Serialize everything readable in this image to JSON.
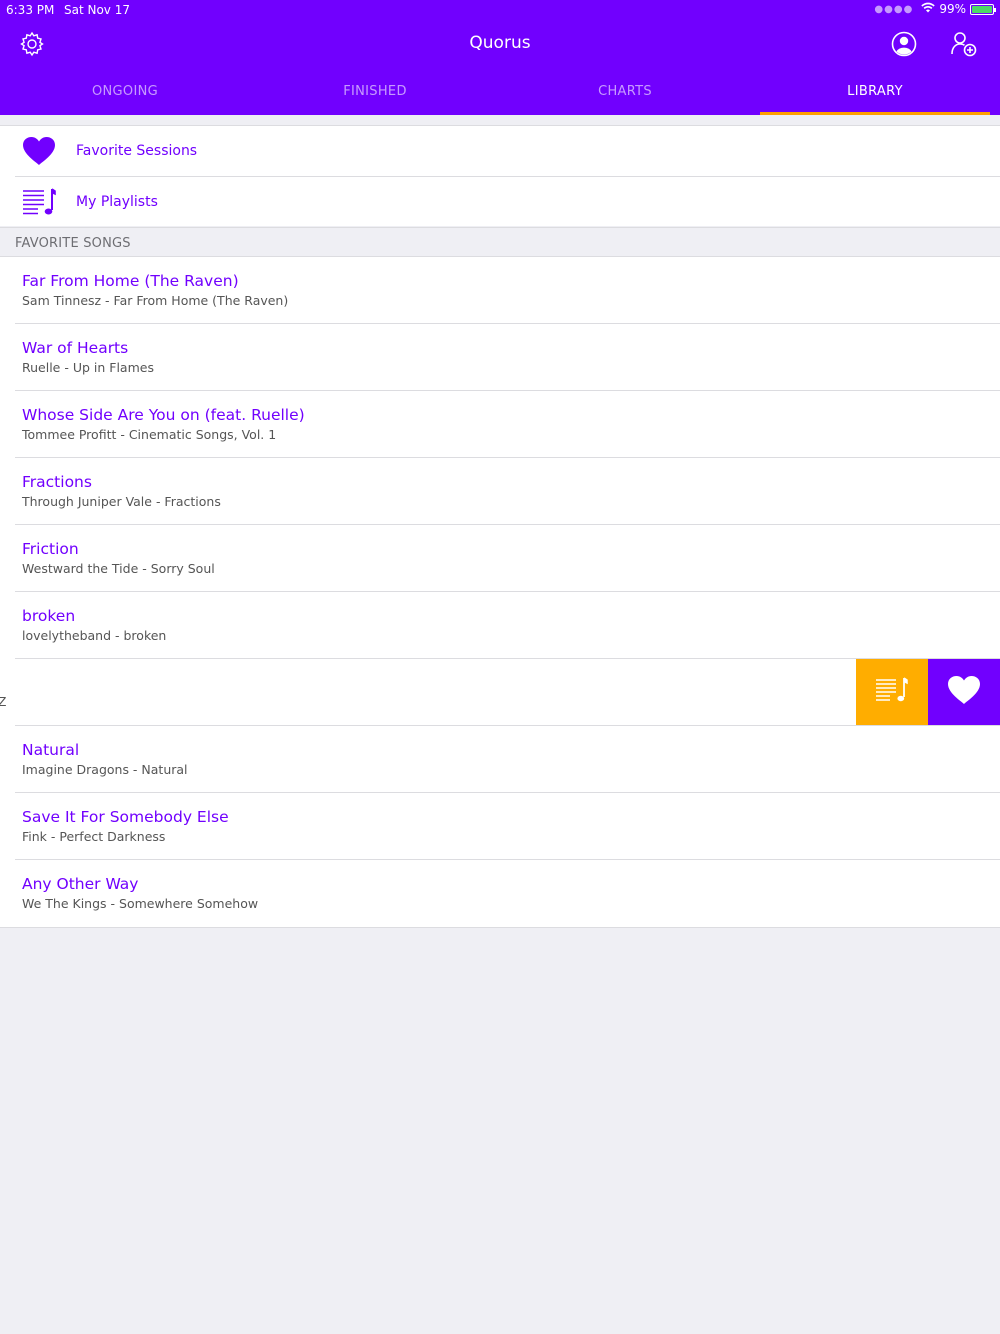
{
  "status_bar": {
    "time": "6:33 PM",
    "date": "Sat Nov 17",
    "battery": "99%"
  },
  "nav": {
    "title": "Quorus",
    "icons": [
      "settings-icon",
      "profile-icon",
      "add-user-icon"
    ]
  },
  "tabs": [
    {
      "label": "ONGOING",
      "active": false
    },
    {
      "label": "FINISHED",
      "active": false
    },
    {
      "label": "CHARTS",
      "active": false
    },
    {
      "label": "LIBRARY",
      "active": true
    }
  ],
  "menu": [
    {
      "label": "Favorite Sessions",
      "icon": "heart-icon"
    },
    {
      "label": "My Playlists",
      "icon": "playlist-icon"
    }
  ],
  "section": {
    "title": "FAVORITE SONGS"
  },
  "songs": [
    {
      "title": "Far From Home (The Raven)",
      "subtitle": "Sam Tinnesz - Far From Home (The Raven)"
    },
    {
      "title": "War of Hearts",
      "subtitle": "Ruelle - Up in Flames"
    },
    {
      "title": "Whose Side Are You on (feat. Ruelle)",
      "subtitle": "Tommee Profitt - Cinematic Songs, Vol. 1"
    },
    {
      "title": "Fractions",
      "subtitle": "Through Juniper Vale - Fractions"
    },
    {
      "title": "Friction",
      "subtitle": "Westward the Tide - Sorry Soul"
    },
    {
      "title": "broken",
      "subtitle": "lovelytheband - broken"
    },
    {
      "title": "",
      "subtitle": "sz"
    },
    {
      "title": "Natural",
      "subtitle": "Imagine Dragons - Natural"
    },
    {
      "title": "Save It For Somebody Else",
      "subtitle": "Fink - Perfect Darkness"
    },
    {
      "title": "Any Other Way",
      "subtitle": "We The Kings - Somewhere Somehow"
    }
  ],
  "swipe_actions": [
    {
      "icon": "add-to-playlist-icon",
      "color": "#ffad00"
    },
    {
      "icon": "heart-icon",
      "color": "#7100fe"
    }
  ],
  "colors": {
    "accent": "#7100fe",
    "tab_indicator": "#ff9f00",
    "playlist_action": "#ffad00"
  }
}
